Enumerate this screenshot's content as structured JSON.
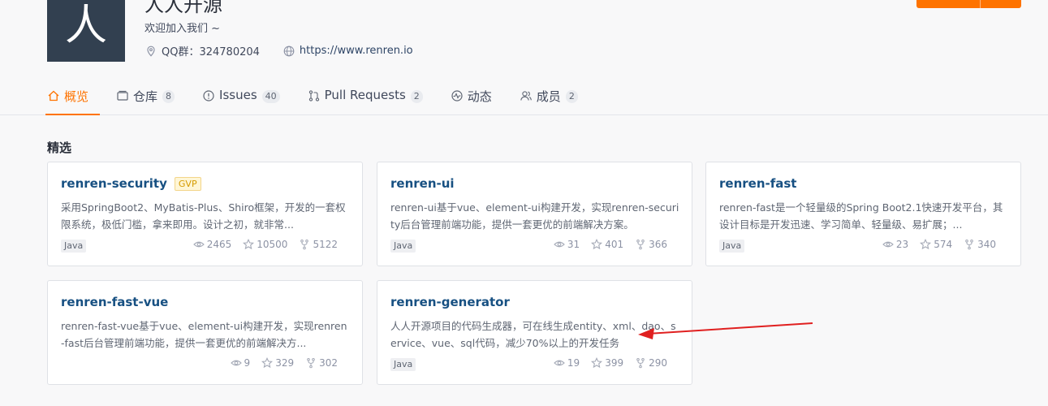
{
  "org": {
    "avatar_char": "人",
    "name": "人人开源",
    "description": "欢迎加入我们 ~",
    "qq": "QQ群：324780204",
    "website": "https://www.renren.io"
  },
  "tabs": [
    {
      "label": "概览",
      "count": ""
    },
    {
      "label": "仓库",
      "count": "8"
    },
    {
      "label": "Issues",
      "count": "40"
    },
    {
      "label": "Pull Requests",
      "count": "2"
    },
    {
      "label": "动态",
      "count": ""
    },
    {
      "label": "成员",
      "count": "2"
    }
  ],
  "featured": {
    "title": "精选",
    "repos": [
      {
        "name": "renren-security",
        "badge": "GVP",
        "desc": "采用SpringBoot2、MyBatis-Plus、Shiro框架，开发的一套权限系统，极低门槛，拿来即用。设计之初，就非常...",
        "lang": "Java",
        "watch": "2465",
        "star": "10500",
        "fork": "5122"
      },
      {
        "name": "renren-ui",
        "badge": "",
        "desc": "renren-ui基于vue、element-ui构建开发，实现renren-security后台管理前端功能，提供一套更优的前端解决方案。",
        "lang": "Java",
        "watch": "31",
        "star": "401",
        "fork": "366"
      },
      {
        "name": "renren-fast",
        "badge": "",
        "desc": "renren-fast是一个轻量级的Spring Boot2.1快速开发平台，其设计目标是开发迅速、学习简单、轻量级、易扩展；...",
        "lang": "Java",
        "watch": "23",
        "star": "574",
        "fork": "340"
      },
      {
        "name": "renren-fast-vue",
        "badge": "",
        "desc": "renren-fast-vue基于vue、element-ui构建开发，实现renren-fast后台管理前端功能，提供一套更优的前端解决方...",
        "lang": "",
        "watch": "9",
        "star": "329",
        "fork": "302"
      },
      {
        "name": "renren-generator",
        "badge": "",
        "desc": "人人开源项目的代码生成器，可在线生成entity、xml、dao、service、vue、sql代码，减少70%以上的开发任务",
        "lang": "Java",
        "watch": "19",
        "star": "399",
        "fork": "290"
      }
    ]
  },
  "colors": {
    "accent": "#fe7300",
    "link": "#175082",
    "annotation_arrow": "#e02020"
  }
}
